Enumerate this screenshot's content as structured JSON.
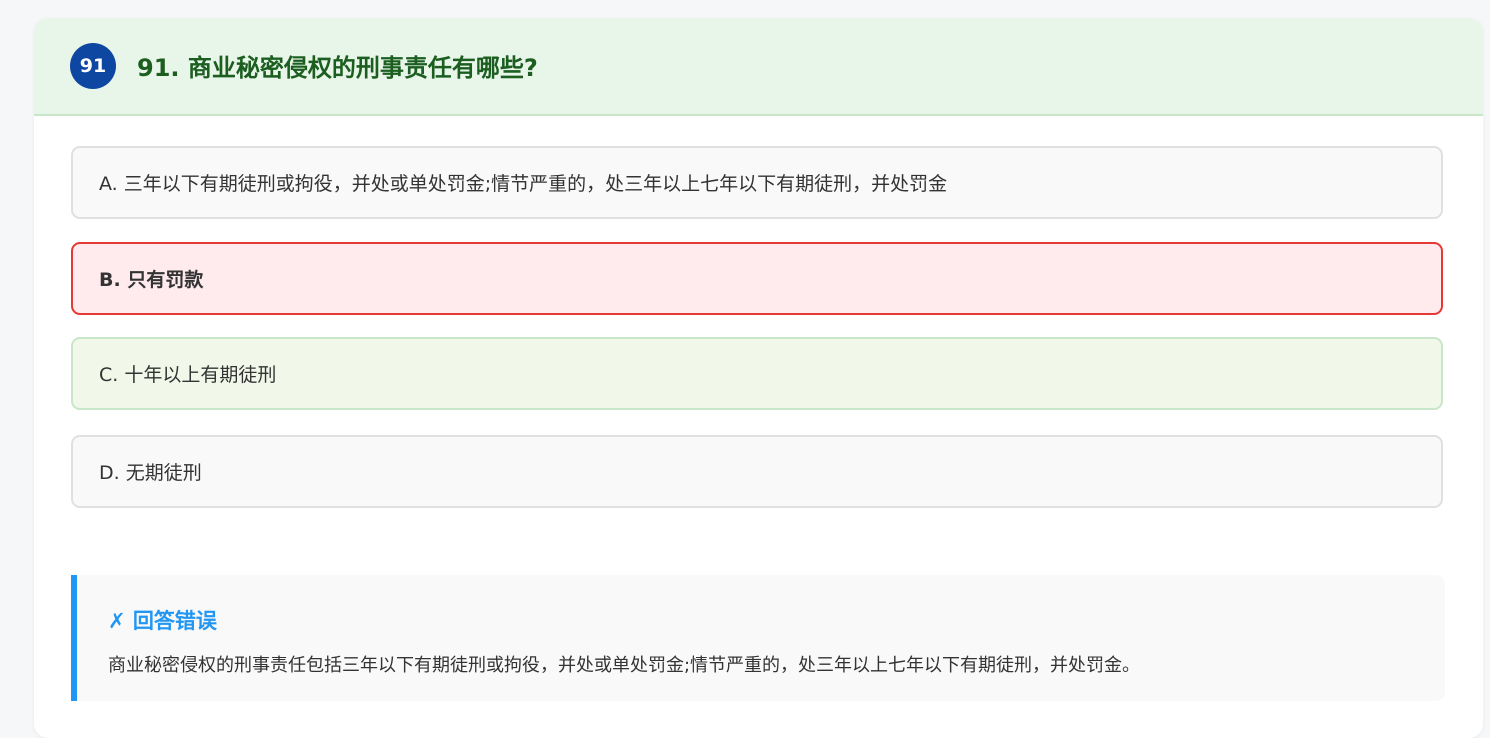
{
  "question": {
    "badge": "91",
    "title": "91. 商业秘密侵权的刑事责任有哪些?"
  },
  "options": [
    {
      "label": "A. 三年以下有期徒刑或拘役，并处或单处罚金;情节严重的，处三年以上七年以下有期徒刑，并处罚金",
      "state": "default"
    },
    {
      "label": "B. 只有罚款",
      "state": "selected-wrong"
    },
    {
      "label": "C. 十年以上有期徒刑",
      "state": "correct"
    },
    {
      "label": "D. 无期徒刑",
      "state": "default"
    }
  ],
  "feedback": {
    "title": "✗ 回答错误",
    "explanation": "商业秘密侵权的刑事责任包括三年以下有期徒刑或拘役，并处或单处罚金;情节严重的，处三年以上七年以下有期徒刑，并处罚金。"
  },
  "colors": {
    "header_bg": "#e8f5e9",
    "title": "#1b5e20",
    "badge": "#0d47a1",
    "wrong_border": "#e53935",
    "wrong_bg": "#ffebee",
    "correct_border": "#c8e6c9",
    "correct_bg": "#f1f8e9",
    "feedback_accent": "#2196f3"
  }
}
